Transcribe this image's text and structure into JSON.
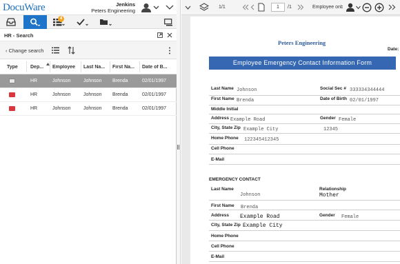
{
  "app": {
    "logo": "DocuWare",
    "user_name": "Jenkins",
    "user_org": "Peters Engineering",
    "toolbar_badge": "4",
    "accent": "#1d74c8"
  },
  "search_panel": {
    "title": "HR - Search",
    "change_search": "Change search",
    "columns": [
      "Type",
      "Dep...",
      "Employee",
      "Last Na...",
      "First Na...",
      "Date of B..."
    ],
    "rows": [
      {
        "type": "image",
        "dep": "HR",
        "employee": "Johnson",
        "last": "Johnson",
        "first": "Brenda",
        "dob": "02/01/1997",
        "selected": true
      },
      {
        "type": "pdf",
        "dep": "HR",
        "employee": "Johnson",
        "last": "Johnson",
        "first": "Brenda",
        "dob": "02/01/1997",
        "selected": false
      },
      {
        "type": "pdf",
        "dep": "HR",
        "employee": "Johnson",
        "last": "Johnson",
        "first": "Brenda",
        "dob": "02/01/1997",
        "selected": false
      }
    ]
  },
  "viewer": {
    "page_count": "1/1",
    "page_input": "1",
    "page_total": "/1",
    "doc_name": "Employee onb"
  },
  "document": {
    "company": "Peters Engineering",
    "date_label": "Date:",
    "form_title": "Employee Emergency Contact Information Form",
    "fields": {
      "last_name_label": "Last Name",
      "last_name": "Johnson",
      "ssn_label": "Social Sec #",
      "ssn": "333334344444",
      "first_name_label": "First Name",
      "first_name": "Brenda",
      "dob_label": "Date of Birth",
      "dob": "02/01/1997",
      "middle_label": "Middle Initial",
      "address_label": "Address",
      "address": "Example Road",
      "gender_label": "Gender",
      "gender": "Female",
      "city_label": "City, State Zip",
      "city": "Example City",
      "zip": "12345",
      "home_phone_label": "Home Phone",
      "home_phone": "122345412345",
      "cell_phone_label": "Cell Phone",
      "email_label": "E-Mail"
    },
    "emergency": {
      "heading": "EMERGENCY CONTACT",
      "last_name_label": "Last Name",
      "last_name": "Johnson",
      "relationship_label": "Relationship",
      "relationship": "Mother",
      "first_name_label": "First Name",
      "first_name": "Brenda",
      "address_label": "Address",
      "address": "Example Road",
      "gender_label": "Gender",
      "gender": "Female",
      "city_label": "City, State Zip",
      "city": "Example City",
      "home_phone_label": "Home Phone",
      "cell_phone_label": "Cell Phone",
      "email_label": "E-Mail"
    }
  }
}
